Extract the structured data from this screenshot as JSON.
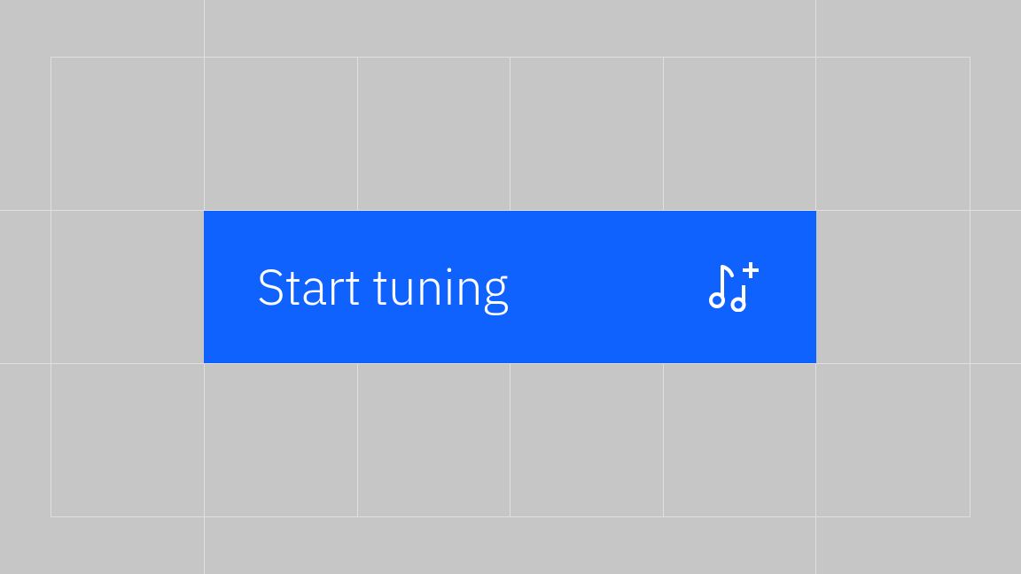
{
  "button": {
    "label": "Start tuning",
    "icon_name": "music-add-icon"
  },
  "colors": {
    "background": "#c6c6c6",
    "grid": "#e0e0e0",
    "primary": "#0f62fe",
    "text_on_primary": "#ffffff"
  }
}
